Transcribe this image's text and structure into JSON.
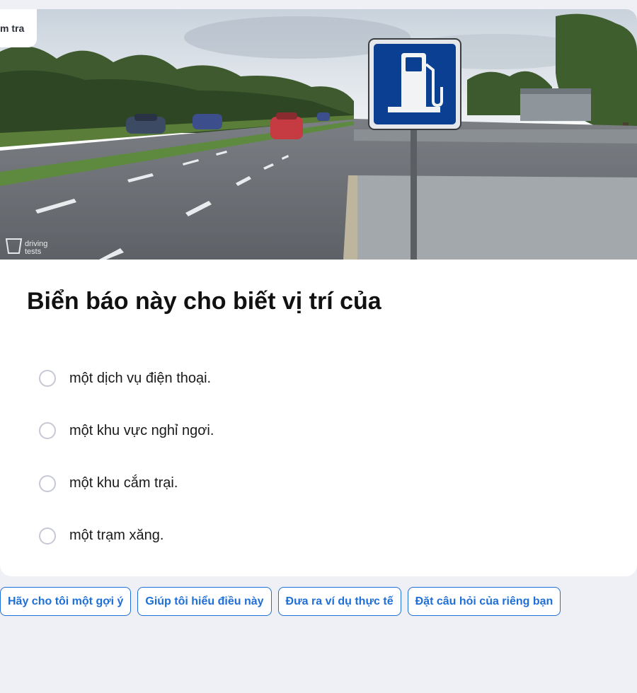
{
  "tag": {
    "label": "m tra"
  },
  "photo": {
    "watermark_line1": "driving",
    "watermark_line2": "tests"
  },
  "question": {
    "title": "Biển báo này cho biết vị trí của",
    "options": [
      {
        "label": "một dịch vụ điện thoại."
      },
      {
        "label": "một khu vực nghỉ ngơi."
      },
      {
        "label": "một khu cắm trại."
      },
      {
        "label": "một trạm xăng."
      }
    ]
  },
  "help_chips": [
    {
      "label": "Hãy cho tôi một gợi ý"
    },
    {
      "label": "Giúp tôi hiểu điều này"
    },
    {
      "label": "Đưa ra ví dụ thực tế"
    },
    {
      "label": "Đặt câu hỏi của riêng bạn"
    }
  ],
  "colors": {
    "accent": "#1f6fd8",
    "sign_blue": "#0b3f92",
    "page_bg": "#eef0f5"
  }
}
